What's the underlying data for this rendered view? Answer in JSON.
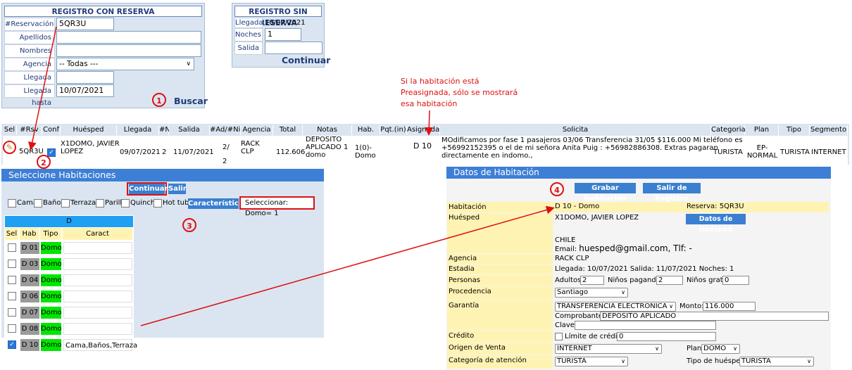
{
  "con_reserva": {
    "title": "REGISTRO CON RESERVA",
    "labels": [
      "#Reservación",
      "Apellidos",
      "Nombres",
      "Agencia",
      "Llegada desde",
      "Llegada hasta"
    ],
    "reservacion_value": "5QR3U",
    "agencia_selected": "-- Todas ---",
    "llegada_hasta_value": "10/07/2021",
    "buscar_label": "Buscar",
    "step": "1"
  },
  "sin_reserva": {
    "title": "REGISTRO SIN RESERVA",
    "llegada_label": "Llegada",
    "llegada_value": "10/07/2021",
    "noches_label": "Noches",
    "noches_value": "1",
    "salida_label": "Salida",
    "continuar_label": "Continuar"
  },
  "note": {
    "line1": "Si la habitación está",
    "line2": "Preasignada, sólo se mostrará",
    "line3": "esa habitación"
  },
  "reservations_table": {
    "headers": [
      "Sel",
      "#Rsv",
      "Conf",
      "Huésped",
      "Llegada",
      "#N",
      "Salida",
      "#Ad/#Ni",
      "Agencia",
      "Total",
      "Notas",
      "Hab.(in)",
      "Pqt.(in)",
      "Asignadas",
      "Solicita",
      "Categoria",
      "Plan",
      "Tipo",
      "Segmento"
    ],
    "row": {
      "rsv": "5QR3U",
      "huesped_1": "X1DOMO, JAVIER",
      "huesped_2": "LOPEZ",
      "llegada": "09/07/2021",
      "noches": "2",
      "salida": "11/07/2021",
      "ad_ni_1": "2/",
      "ad_ni_2": "2",
      "agencia_1": "RACK",
      "agencia_2": "CLP",
      "total": "112.606",
      "notas_1": "DEPOSITO",
      "notas_2": "APLICADO 1",
      "notas_3": "domo",
      "hab_in_1": "1(0)-",
      "hab_in_2": "Domo",
      "asignadas": "D 10",
      "solicita_1": "MOdificamos por fase 1 pasajeros 03/06 Transferencia 31/05 $116.000 Mi teléfono es",
      "solicita_2": "+56992152395 o el de mi señora Anita Puig : +56982886308. Extras pagaran",
      "solicita_3": "directamente en indomo.,",
      "categoria": "TURISTA",
      "plan_1": "EP-",
      "plan_2": "NORMAL",
      "tipo": "TURISTA",
      "segmento": "INTERNET",
      "confirmed": true
    },
    "step": "2"
  },
  "seleccione": {
    "title": "Seleccione Habitaciones",
    "continuar_label": "Continuar",
    "salir_label": "Salir",
    "filters": [
      "Cama",
      "Baños",
      "Terraza",
      "Parilla",
      "Quincho",
      "Hot tub"
    ],
    "caracteristicas_label": "Características",
    "seleccionar_info": "Seleccionar: Domo= 1",
    "step": "3",
    "group_header": "D",
    "col_headers": [
      "Sel",
      "Hab",
      "Tipo",
      "Caract"
    ],
    "rooms": [
      {
        "hab": "D 01",
        "tipo": "Domo",
        "caract": "",
        "checked": false
      },
      {
        "hab": "D 03",
        "tipo": "Domo",
        "caract": "",
        "checked": false
      },
      {
        "hab": "D 04",
        "tipo": "Domo",
        "caract": "",
        "checked": false
      },
      {
        "hab": "D 06",
        "tipo": "Domo",
        "caract": "",
        "checked": false
      },
      {
        "hab": "D 07",
        "tipo": "Domo",
        "caract": "",
        "checked": false
      },
      {
        "hab": "D 08",
        "tipo": "Domo",
        "caract": "",
        "checked": false
      },
      {
        "hab": "D 10",
        "tipo": "Domo",
        "caract": "Cama,Baños,Terraza",
        "checked": true
      }
    ]
  },
  "datos": {
    "title": "Datos de Habitación",
    "step": "4",
    "grabar_label": "Grabar Habitación",
    "salir_registro_label": "Salir de Registro",
    "habitacion_label": "Habitación",
    "habitacion_value": "D 10 - Domo",
    "reserva_text": "Reserva:  5QR3U",
    "huesped_label": "Huésped",
    "huesped_name": "X1DOMO, JAVIER LOPEZ",
    "datos_huesped_label": "Datos de Huésped",
    "pais": "CHILE",
    "email_prefix": "Email: ",
    "email_value": "huesped@gmail.com",
    "tlf_text": ", Tlf: -",
    "agencia_label": "Agencia",
    "agencia_value": "RACK CLP",
    "estadia_label": "Estadia",
    "estadia_value": "Llegada:  10/07/2021  Salida:  11/07/2021  Noches:  1",
    "personas_label": "Personas",
    "adultos_label": "Adultos:",
    "adultos_value": "2",
    "ninos_pagando_label": "Niños pagando:",
    "ninos_pagando_value": "2",
    "ninos_gratis_label": "Niños gratis:",
    "ninos_gratis_value": "0",
    "procedencia_label": "Procedencia",
    "procedencia_value": "Santiago",
    "garantia_label": "Garantía",
    "garantia_value": "TRANSFERENCIA ELECTRONICA",
    "monto_label": "Monto:",
    "monto_value": "116.000",
    "comprobante_label": "Comprobante:",
    "comprobante_value": "DEPOSITO APLICADO",
    "clave_label": "Clave:",
    "credito_label": "Crédito",
    "limite_label": "Límite de crédito:",
    "limite_value": "0",
    "origen_label": "Origen de Venta",
    "origen_value": "INTERNET",
    "plan_label": "Plan",
    "plan_value": "DOMO",
    "categoria_label": "Categoría de atención",
    "categoria_value": "TURISTA",
    "tipo_huesped_label": "Tipo de huésped",
    "tipo_huesped_value": "TURISTA"
  },
  "colors": {
    "panel_bg": "#dbe5f1",
    "title_blue": "#1f3b7a",
    "header_blue": "#3d7fd6",
    "domo_green": "#00e600",
    "hab_gray": "#9a9a9a",
    "annotation_red": "#dd1111",
    "label_yellow": "#fff3b3"
  }
}
